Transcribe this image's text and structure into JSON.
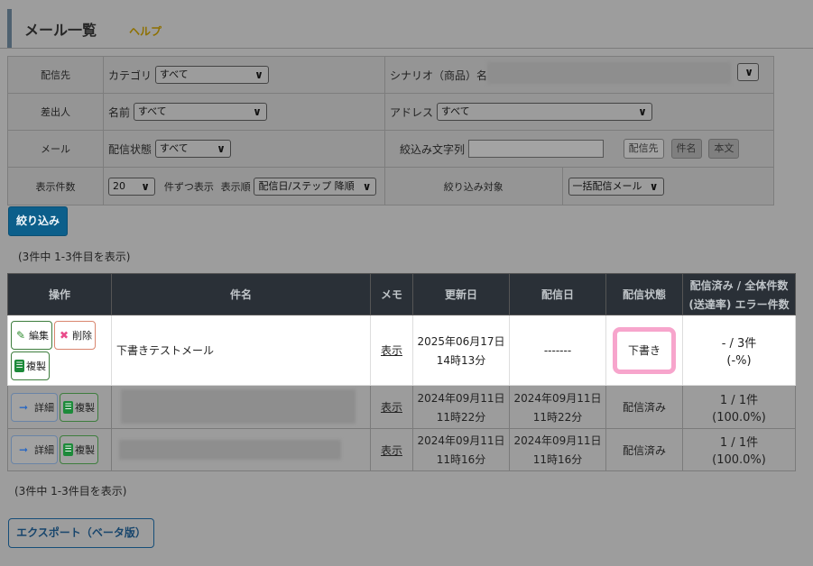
{
  "header": {
    "title": "メール一覧",
    "help": "ヘルプ"
  },
  "filters": {
    "row1": {
      "label": "配信先",
      "category_label": "カテゴリ",
      "category_value": "すべて",
      "scenario_label": "シナリオ（商品）名"
    },
    "row2": {
      "label": "差出人",
      "name_label": "名前",
      "name_value": "すべて",
      "address_label": "アドレス",
      "address_value": "すべて"
    },
    "row3": {
      "label": "メール",
      "state_label": "配信状態",
      "state_value": "すべて",
      "keyword_label": "絞込み文字列",
      "keyword_value": "",
      "target_buttons": [
        "配信先",
        "件名",
        "本文"
      ]
    },
    "row4": {
      "label": "表示件数",
      "count_value": "20",
      "count_suffix": "件ずつ表示",
      "order_label": "表示順",
      "order_value": "配信日/ステップ 降順",
      "target_label": "絞り込み対象",
      "target_value": "一括配信メール"
    }
  },
  "narrow_button": "絞り込み",
  "count_text": "(3件中 1-3件目を表示)",
  "table": {
    "headers": {
      "ops": "操作",
      "subject": "件名",
      "memo": "メモ",
      "updated": "更新日",
      "sent": "配信日",
      "state": "配信状態",
      "stats_line1": "配信済み / 全体件数",
      "stats_line2": "(送達率) エラー件数"
    },
    "rows": [
      {
        "buttons": [
          "編集",
          "削除",
          "複製"
        ],
        "subject": "下書きテストメール",
        "memo": "表示",
        "updated_date": "2025年06月17日",
        "updated_time": "14時13分",
        "sent_date": "-------",
        "sent_time": "",
        "state": "下書き",
        "stats_count": "- / 3件",
        "stats_rate": "(-%)"
      },
      {
        "buttons": [
          "詳細",
          "複製"
        ],
        "subject": "",
        "memo": "表示",
        "updated_date": "2024年09月11日",
        "updated_time": "11時22分",
        "sent_date": "2024年09月11日",
        "sent_time": "11時22分",
        "state": "配信済み",
        "stats_count": "1 / 1件",
        "stats_rate": "(100.0%)"
      },
      {
        "buttons": [
          "詳細",
          "複製"
        ],
        "subject": "",
        "memo": "表示",
        "updated_date": "2024年09月11日",
        "updated_time": "11時16分",
        "sent_date": "2024年09月11日",
        "sent_time": "11時16分",
        "state": "配信済み",
        "stats_count": "1 / 1件",
        "stats_rate": "(100.0%)"
      }
    ]
  },
  "export_button": "エクスポート（ベータ版）",
  "colors": {
    "accent": "#0c5f8b",
    "header_bg": "#2a3037",
    "highlight": "#f7a5cc",
    "overlay": "#9d9d9d"
  },
  "icons": {
    "edit": "pencil-icon",
    "delete": "x-icon",
    "copy": "copy-icon",
    "detail": "arrow-right-icon",
    "dropdown": "chevron-down-icon"
  }
}
